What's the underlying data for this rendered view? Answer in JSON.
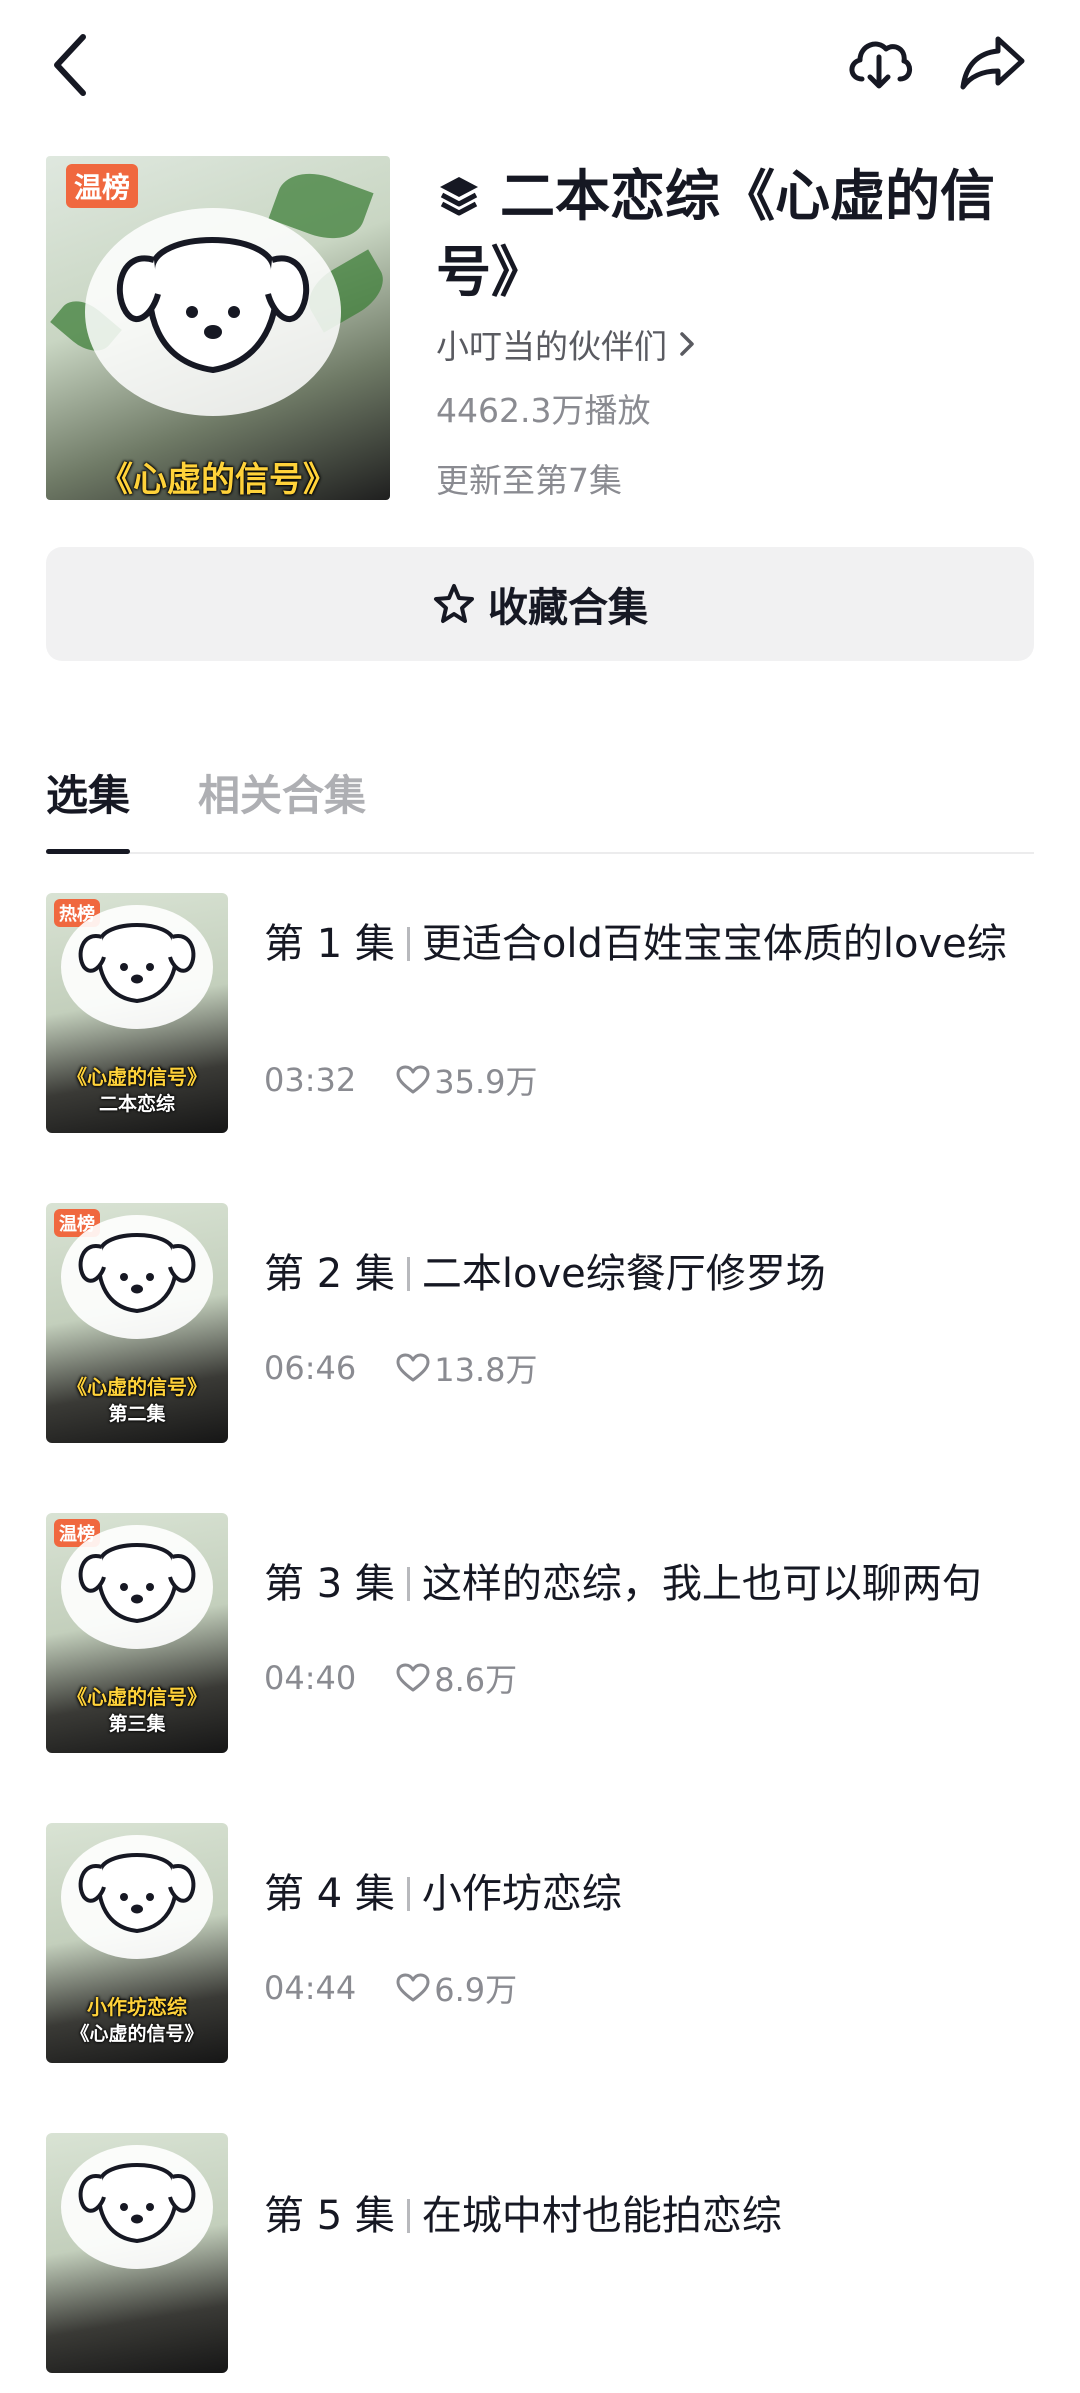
{
  "header": {
    "badge": "温榜",
    "cover_caption": "《心虚的信号》",
    "title": "二本恋综《心虚的信号》",
    "author": "小叮当的伙伴们",
    "plays": "4462.3万播放",
    "update": "更新至第7集",
    "collect_label": "收藏合集"
  },
  "icons": {
    "back": "back-arrow-icon",
    "download": "cloud-download-icon",
    "share": "share-icon",
    "collection": "stack-icon",
    "star": "star-icon",
    "heart": "heart-icon"
  },
  "tabs": [
    {
      "label": "选集",
      "active": true
    },
    {
      "label": "相关合集",
      "active": false
    }
  ],
  "episodes": [
    {
      "num": "第 1 集",
      "title": "更适合old百姓宝宝体质的love综",
      "duration": "03:32",
      "likes": "35.9万",
      "badge": "热榜",
      "cap1": "《心虚的信号》",
      "cap2": "二本恋综"
    },
    {
      "num": "第 2 集",
      "title": "二本love综餐厅修罗场",
      "duration": "06:46",
      "likes": "13.8万",
      "badge": "温榜",
      "cap1": "《心虚的信号》",
      "cap2": "第二集"
    },
    {
      "num": "第 3 集",
      "title": "这样的恋综，我上也可以聊两句",
      "duration": "04:40",
      "likes": "8.6万",
      "badge": "温榜",
      "cap1": "《心虚的信号》",
      "cap2": "第三集"
    },
    {
      "num": "第 4 集",
      "title": "小作坊恋综",
      "duration": "04:44",
      "likes": "6.9万",
      "badge": "",
      "cap1": "小作坊恋综",
      "cap2": "《心虚的信号》"
    },
    {
      "num": "第 5 集",
      "title": "在城中村也能拍恋综",
      "duration": "",
      "likes": "",
      "badge": "",
      "cap1": "",
      "cap2": ""
    }
  ]
}
